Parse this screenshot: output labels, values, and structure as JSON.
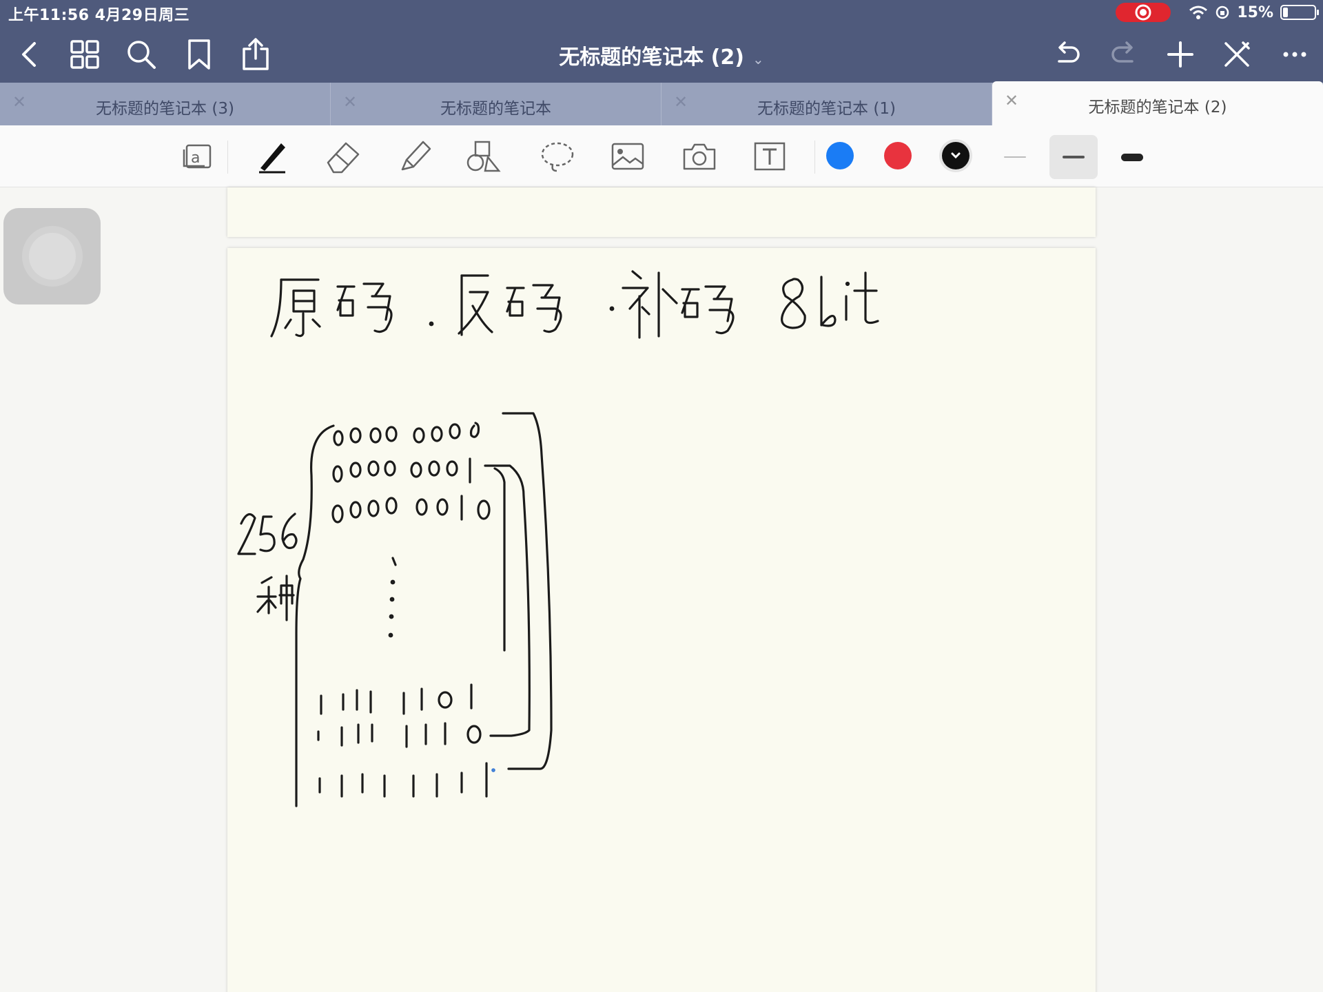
{
  "status_bar": {
    "time": "上午11:56  4月29日周三",
    "battery": "15%",
    "battery_level": 0.15
  },
  "nav": {
    "title": "无标题的笔记本 (2)",
    "title_chevron": "⌄",
    "left_icons": [
      "back-icon",
      "grid-icon",
      "search-icon",
      "bookmark-icon",
      "share-icon"
    ],
    "right_icons": [
      "undo-icon",
      "redo-icon",
      "add-page-icon",
      "close-edit-icon",
      "more-icon"
    ]
  },
  "tabs": [
    {
      "label": "无标题的笔记本 (3)",
      "active": false
    },
    {
      "label": "无标题的笔记本",
      "active": false
    },
    {
      "label": "无标题的笔记本 (1)",
      "active": false
    },
    {
      "label": "无标题的笔记本 (2)",
      "active": true
    }
  ],
  "toolbar": {
    "tools": [
      "read-mode-icon",
      "pen-icon",
      "eraser-icon",
      "highlighter-icon",
      "shapes-icon",
      "lasso-icon",
      "image-icon",
      "camera-icon",
      "text-icon"
    ],
    "selected_tool": "pen-icon",
    "colors": [
      "#1a7cf5",
      "#e8333e",
      "#111111"
    ],
    "selected_color": "#111111",
    "stroke_widths": [
      "thin",
      "medium",
      "thick"
    ],
    "selected_width": "medium"
  },
  "ink_colors": {
    "ink": "#1b1b1b"
  }
}
